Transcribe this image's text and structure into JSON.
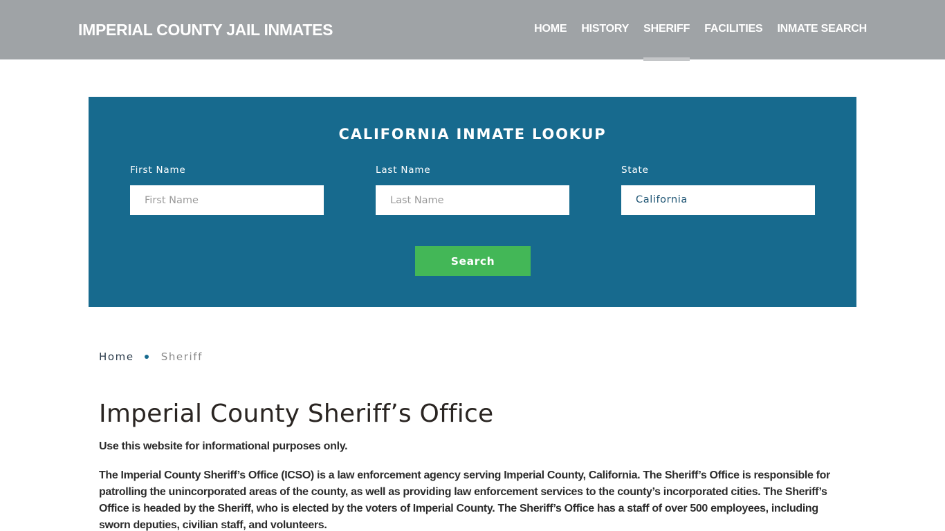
{
  "header": {
    "brand": "IMPERIAL COUNTY JAIL INMATES",
    "nav": [
      {
        "label": "HOME",
        "active": false
      },
      {
        "label": "HISTORY",
        "active": false
      },
      {
        "label": "SHERIFF",
        "active": true
      },
      {
        "label": "FACILITIES",
        "active": false
      },
      {
        "label": "INMATE SEARCH",
        "active": false
      }
    ]
  },
  "lookup": {
    "title": "CALIFORNIA INMATE LOOKUP",
    "first_name": {
      "label": "First Name",
      "placeholder": "First Name",
      "value": ""
    },
    "last_name": {
      "label": "Last Name",
      "placeholder": "Last Name",
      "value": ""
    },
    "state": {
      "label": "State",
      "value": "California"
    },
    "search_label": "Search",
    "colors": {
      "panel": "#176a8e",
      "button": "#43b757"
    }
  },
  "breadcrumb": {
    "home": "Home",
    "current": "Sheriff"
  },
  "content": {
    "title": "Imperial County Sheriff’s Office",
    "disclaimer": "Use this website for informational purposes only.",
    "paragraph": "The Imperial County Sheriff’s Office (ICSO) is a law enforcement agency serving Imperial County, California. The Sheriff’s Office is responsible for patrolling the unincorporated areas of the county, as well as providing law enforcement services to the county’s incorporated cities. The Sheriff’s Office is headed by the Sheriff, who is elected by the voters of Imperial County. The Sheriff’s Office has a staff of over 500 employees, including sworn deputies, civilian staff, and volunteers."
  }
}
